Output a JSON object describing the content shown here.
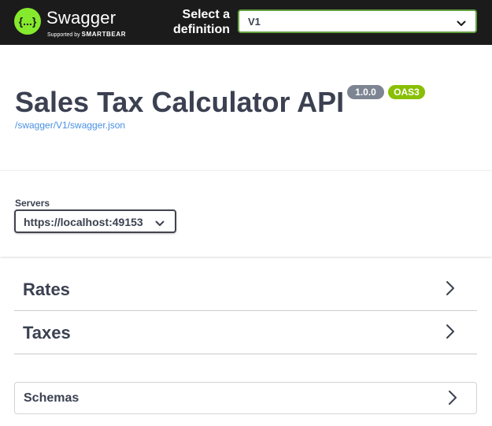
{
  "topbar": {
    "logo": {
      "name": "Swagger",
      "sub_prefix": "Supported by",
      "sub_brand": "SMARTBEAR",
      "glyph": "{...}"
    },
    "select_label_line1": "Select a",
    "select_label_line2": "definition",
    "definition_value": "V1"
  },
  "info": {
    "title": "Sales Tax Calculator API",
    "version_badge": "1.0.0",
    "oas_badge": "OAS3",
    "spec_url": "/swagger/V1/swagger.json"
  },
  "servers": {
    "label": "Servers",
    "selected": "https://localhost:49153"
  },
  "tags": [
    {
      "name": "Rates"
    },
    {
      "name": "Taxes"
    }
  ],
  "schemas": {
    "label": "Schemas"
  },
  "colors": {
    "topbar_bg": "#1b1b1b",
    "logo_green": "#85ea2d",
    "select_border": "#62a03f",
    "version_badge": "#7d8492",
    "oas_badge": "#89bf04",
    "link": "#4990e2",
    "text": "#3b4151"
  }
}
